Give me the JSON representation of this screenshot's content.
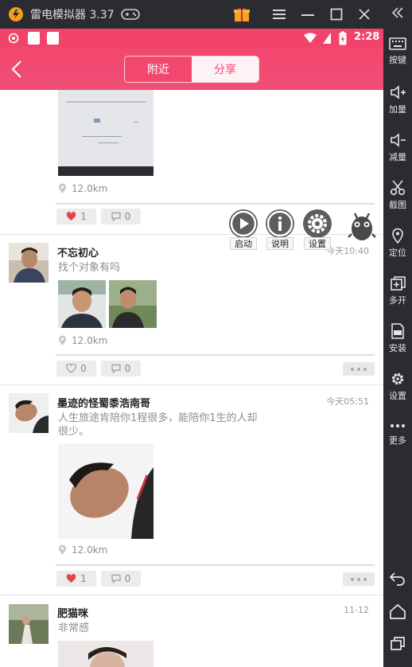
{
  "emulator": {
    "title": "雷电模拟器 3.37",
    "toolbar": [
      {
        "icon": "keyboard-icon",
        "label": "按键"
      },
      {
        "icon": "volume-up-icon",
        "label": "加量"
      },
      {
        "icon": "volume-down-icon",
        "label": "减量"
      },
      {
        "icon": "scissors-icon",
        "label": "截图"
      },
      {
        "icon": "location-pin-icon",
        "label": "定位"
      },
      {
        "icon": "multi-open-icon",
        "label": "多开"
      },
      {
        "icon": "apk-install-icon",
        "label": "安装"
      },
      {
        "icon": "gear-icon",
        "label": "设置"
      },
      {
        "icon": "more-dots-icon",
        "label": "更多"
      }
    ]
  },
  "status_bar": {
    "time": "2:28",
    "bg_color": "#f2446a"
  },
  "app_bar": {
    "tabs": [
      {
        "label": "附近",
        "active": false
      },
      {
        "label": "分享",
        "active": true
      }
    ]
  },
  "posts": [
    {
      "location": "12.0km",
      "likes": "1",
      "comments": "0",
      "liked": true
    },
    {
      "username": "不忘初心",
      "time": "今天10:40",
      "text": "找个对象有吗",
      "location": "12.0km",
      "likes": "0",
      "comments": "0",
      "liked": false
    },
    {
      "username": "墨迹的怪蜀黍浩南哥",
      "time": "今天05:51",
      "text_line1": "人生旅途肯陪你1程很多，能陪你1生的人却",
      "text_line2": "很少。",
      "location": "12.0km",
      "likes": "1",
      "comments": "0",
      "liked": true
    },
    {
      "username": "肥猫咪",
      "time": "11-12",
      "text": "非常感"
    }
  ],
  "floating_menu": [
    {
      "icon": "play-icon",
      "label": "启动"
    },
    {
      "icon": "info-icon",
      "label": "说明"
    },
    {
      "icon": "gear-icon",
      "label": "设置"
    }
  ],
  "colors": {
    "accent": "#f2446a",
    "like_red": "#e0474c"
  }
}
